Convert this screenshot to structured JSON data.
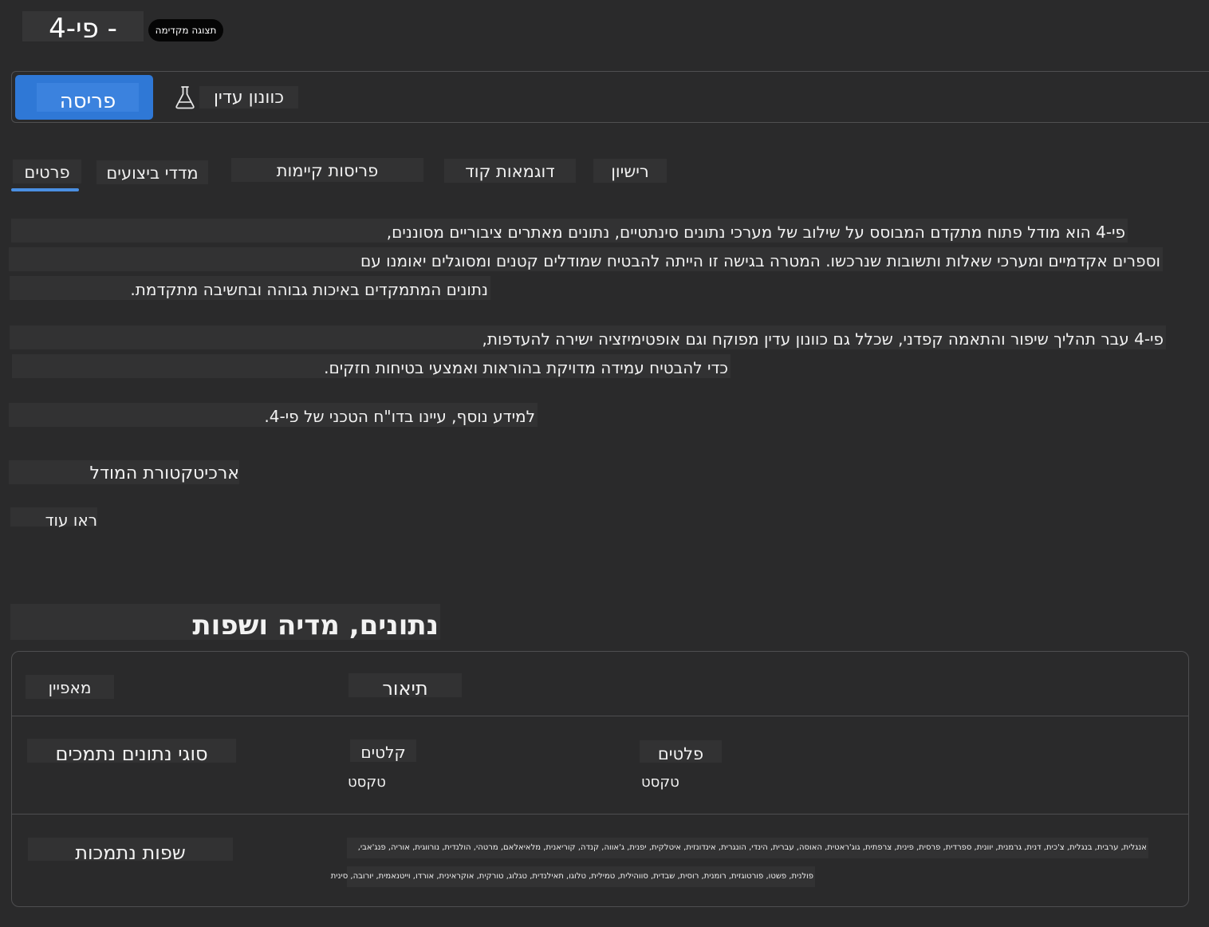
{
  "header": {
    "title": "פי-4 -",
    "preview_badge": "תצוגה מקדימה"
  },
  "actions": {
    "deploy_label": "פריסה",
    "playground_label": "כוונון עדין"
  },
  "tabs": [
    {
      "label": "פרטים",
      "active": true
    },
    {
      "label": "מדדי ביצועים"
    },
    {
      "label": "פריסות קיימות"
    },
    {
      "label": "דוגמאות קוד"
    },
    {
      "label": "רישיון"
    }
  ],
  "description": {
    "p1_l1": "פי-4 הוא מודל פתוח מתקדם המבוסס על שילוב של מערכי נתונים סינתטיים, נתונים מאתרים ציבוריים מסוננים,",
    "p1_l2": "וספרים אקדמיים ומערכי שאלות ותשובות שנרכשו. המטרה בגישה זו הייתה להבטיח שמודלים קטנים ומסוגלים יאומנו עם",
    "p1_l3": "נתונים המתמקדים באיכות גבוהה ובחשיבה מתקדמת.",
    "p2_l1": "פי-4 עבר תהליך שיפור והתאמה קפדני, שכלל גם כוונון עדין מפוקח וגם אופטימיזציה ישירה להעדפות,",
    "p2_l2": "כדי להבטיח עמידה מדויקת בהוראות ואמצעי בטיחות חזקים.",
    "p3": "למידע נוסף, עיינו בדו\"ח הטכני של פי-4."
  },
  "architecture_heading": "ארכיטקטורת המודל",
  "see_more": "ראו עוד",
  "section_heading": "נתונים, מדיה ושפות",
  "table": {
    "header_feature": "מאפיין",
    "header_description": "תיאור",
    "row_types_label": "סוגי נתונים נתמכים",
    "inputs_label": "קלטים",
    "inputs_value": "טקסט",
    "outputs_label": "פלטים",
    "outputs_value": "טקסט",
    "row_languages_label": "שפות נתמכות",
    "languages_line1": "אנגלית, ערבית, בנגלית, צ'כית, דנית, גרמנית, יוונית, ספרדית, פרסית, פינית, צרפתית, גוג'ראטית, האוסה, עברית, הינדי, הונגרית, אינדונזית, איטלקית, יפנית, ג'אווה, קנדה, קוריאנית, מלאיאלאם, מרטהי, הולנדית, נורווגית, אוריה, פנג'אבי,",
    "languages_line2": "פולנית, פשטו, פורטוגזית, רומנית, רוסית, שבדית, סווהילית, טמילית, טלוגו, תאילנדית, טגלוג, טורקית, אוקראינית, אורדו, וייטנאמית, יורובה, סינית"
  },
  "colors": {
    "background": "#2a2a2b",
    "accent": "#2f78d6",
    "tab_underline": "#4a8fe2",
    "badge": "#050505"
  },
  "icons": {
    "playground": "flask-icon"
  }
}
